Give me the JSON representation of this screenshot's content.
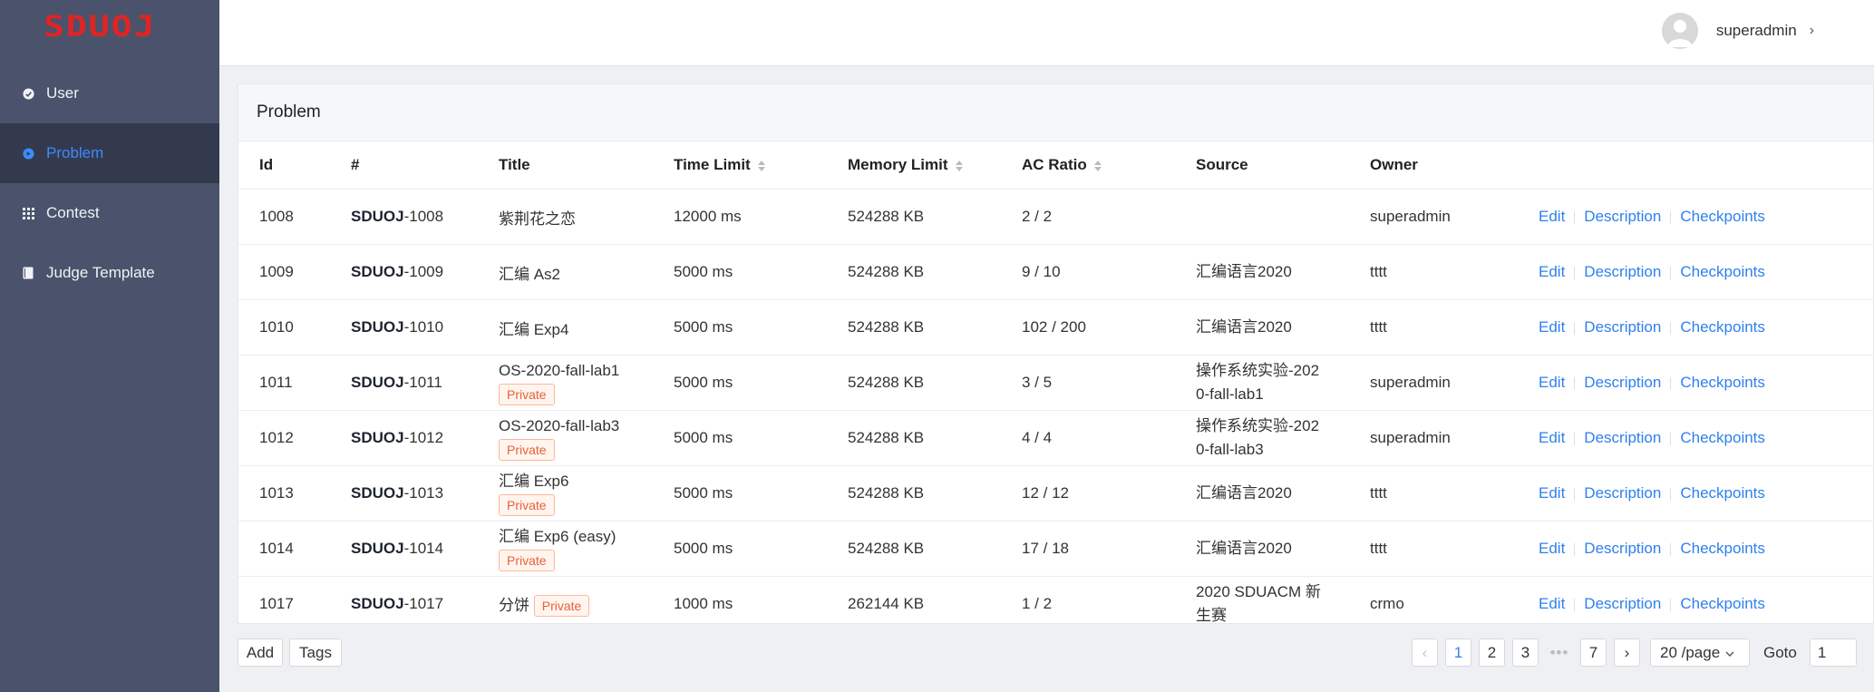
{
  "app": {
    "logo": "SDUOJ"
  },
  "sidebar": {
    "items": [
      {
        "label": "User",
        "icon": "user-icon",
        "active": false
      },
      {
        "label": "Problem",
        "icon": "problem-icon",
        "active": true
      },
      {
        "label": "Contest",
        "icon": "grid-icon",
        "active": false
      },
      {
        "label": "Judge Template",
        "icon": "book-icon",
        "active": false
      }
    ]
  },
  "header": {
    "username": "superadmin"
  },
  "card": {
    "title": "Problem"
  },
  "table": {
    "columns": [
      "Id",
      "#",
      "Title",
      "Time Limit",
      "Memory Limit",
      "AC Ratio",
      "Source",
      "Owner"
    ],
    "sortable": [
      "Time Limit",
      "Memory Limit",
      "AC Ratio"
    ],
    "rows": [
      {
        "id": "1008",
        "prefix": "SDUOJ",
        "num": "-1008",
        "title": "紫荆花之恋",
        "private": false,
        "time": "12000 ms",
        "memory": "524288 KB",
        "ac": "2 / 2",
        "source": [
          "",
          ""
        ],
        "owner": "superadmin"
      },
      {
        "id": "1009",
        "prefix": "SDUOJ",
        "num": "-1009",
        "title": "汇编 As2",
        "private": false,
        "time": "5000 ms",
        "memory": "524288 KB",
        "ac": "9 / 10",
        "source": [
          "汇编语言2020",
          ""
        ],
        "owner": "tttt"
      },
      {
        "id": "1010",
        "prefix": "SDUOJ",
        "num": "-1010",
        "title": "汇编 Exp4",
        "private": false,
        "time": "5000 ms",
        "memory": "524288 KB",
        "ac": "102 / 200",
        "source": [
          "汇编语言2020",
          ""
        ],
        "owner": "tttt"
      },
      {
        "id": "1011",
        "prefix": "SDUOJ",
        "num": "-1011",
        "title": "OS-2020-fall-lab1",
        "private": true,
        "time": "5000 ms",
        "memory": "524288 KB",
        "ac": "3 / 5",
        "source": [
          "操作系统实验-202",
          "0-fall-lab1"
        ],
        "owner": "superadmin"
      },
      {
        "id": "1012",
        "prefix": "SDUOJ",
        "num": "-1012",
        "title": "OS-2020-fall-lab3",
        "private": true,
        "time": "5000 ms",
        "memory": "524288 KB",
        "ac": "4 / 4",
        "source": [
          "操作系统实验-202",
          "0-fall-lab3"
        ],
        "owner": "superadmin"
      },
      {
        "id": "1013",
        "prefix": "SDUOJ",
        "num": "-1013",
        "title": "汇编 Exp6",
        "private": true,
        "time": "5000 ms",
        "memory": "524288 KB",
        "ac": "12 / 12",
        "source": [
          "汇编语言2020",
          ""
        ],
        "owner": "tttt"
      },
      {
        "id": "1014",
        "prefix": "SDUOJ",
        "num": "-1014",
        "title": "汇编 Exp6 (easy)",
        "private": true,
        "time": "5000 ms",
        "memory": "524288 KB",
        "ac": "17 / 18",
        "source": [
          "汇编语言2020",
          ""
        ],
        "owner": "tttt"
      },
      {
        "id": "1017",
        "prefix": "SDUOJ",
        "num": "-1017",
        "title": "分饼",
        "private": true,
        "inline_tag": true,
        "time": "1000 ms",
        "memory": "262144 KB",
        "ac": "1 / 2",
        "source": [
          "2020 SDUACM 新",
          "生赛"
        ],
        "owner": "crmo"
      }
    ],
    "private_label": "Private",
    "actions": [
      "Edit",
      "Description",
      "Checkpoints"
    ]
  },
  "footer": {
    "add_label": "Add",
    "tags_label": "Tags",
    "pages": [
      "1",
      "2",
      "3",
      "7"
    ],
    "current_page": "1",
    "ellipsis": "•••",
    "page_size": "20 /page",
    "goto_label": "Goto",
    "goto_value": "1"
  },
  "colors": {
    "sidebar": "#4a536b",
    "sidebar_active": "#343a4d",
    "accent": "#2f80ed",
    "logo": "#e02424",
    "private_tag": "#e8623b"
  }
}
